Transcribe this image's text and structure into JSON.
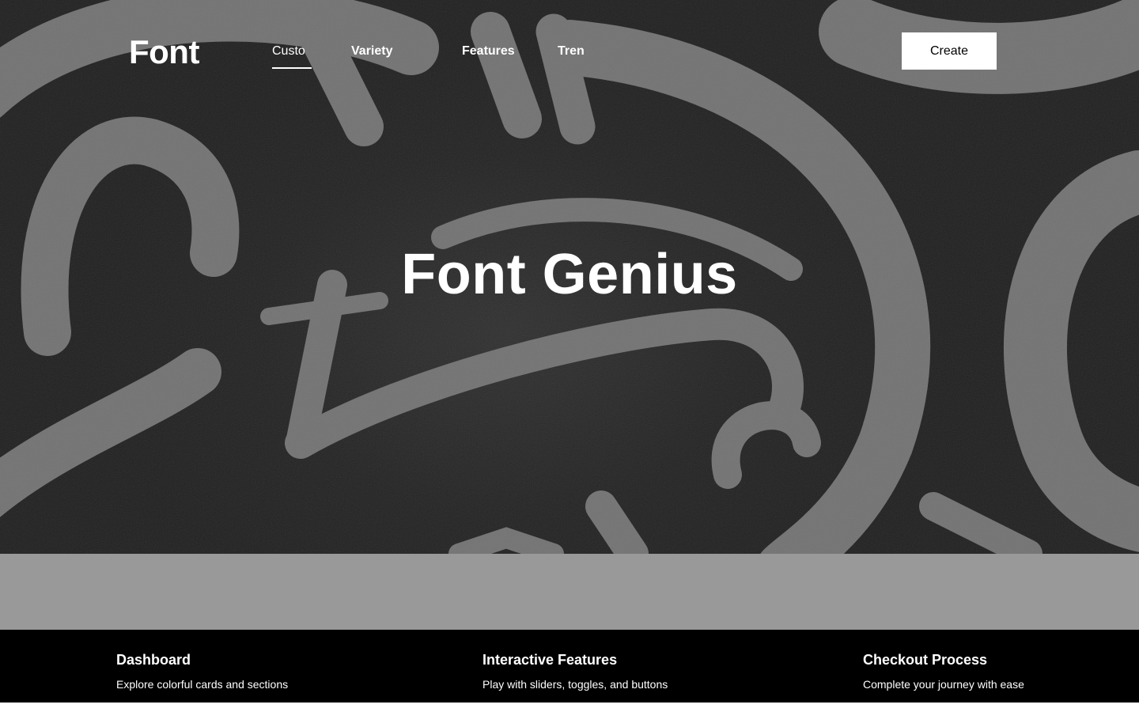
{
  "header": {
    "logo": "Font",
    "nav": [
      {
        "label": "Custo",
        "active": true
      },
      {
        "label": "Variety",
        "active": false
      },
      {
        "label": "Features",
        "active": false
      },
      {
        "label": "Tren",
        "active": false
      }
    ],
    "cta_label": "Create"
  },
  "hero": {
    "title": "Font Genius",
    "background_description": "grayscale photo of carved stone letters"
  },
  "cards": [
    {
      "title": "Dashboard",
      "description": "Explore colorful cards and sections"
    },
    {
      "title": "Interactive Features",
      "description": "Play with sliders, toggles, and buttons"
    },
    {
      "title": "Checkout Process",
      "description": "Complete your journey with ease"
    }
  ],
  "colors": {
    "band": "#999999",
    "footer": "#000000",
    "text": "#ffffff",
    "button_bg": "#ffffff",
    "button_text": "#000000"
  }
}
